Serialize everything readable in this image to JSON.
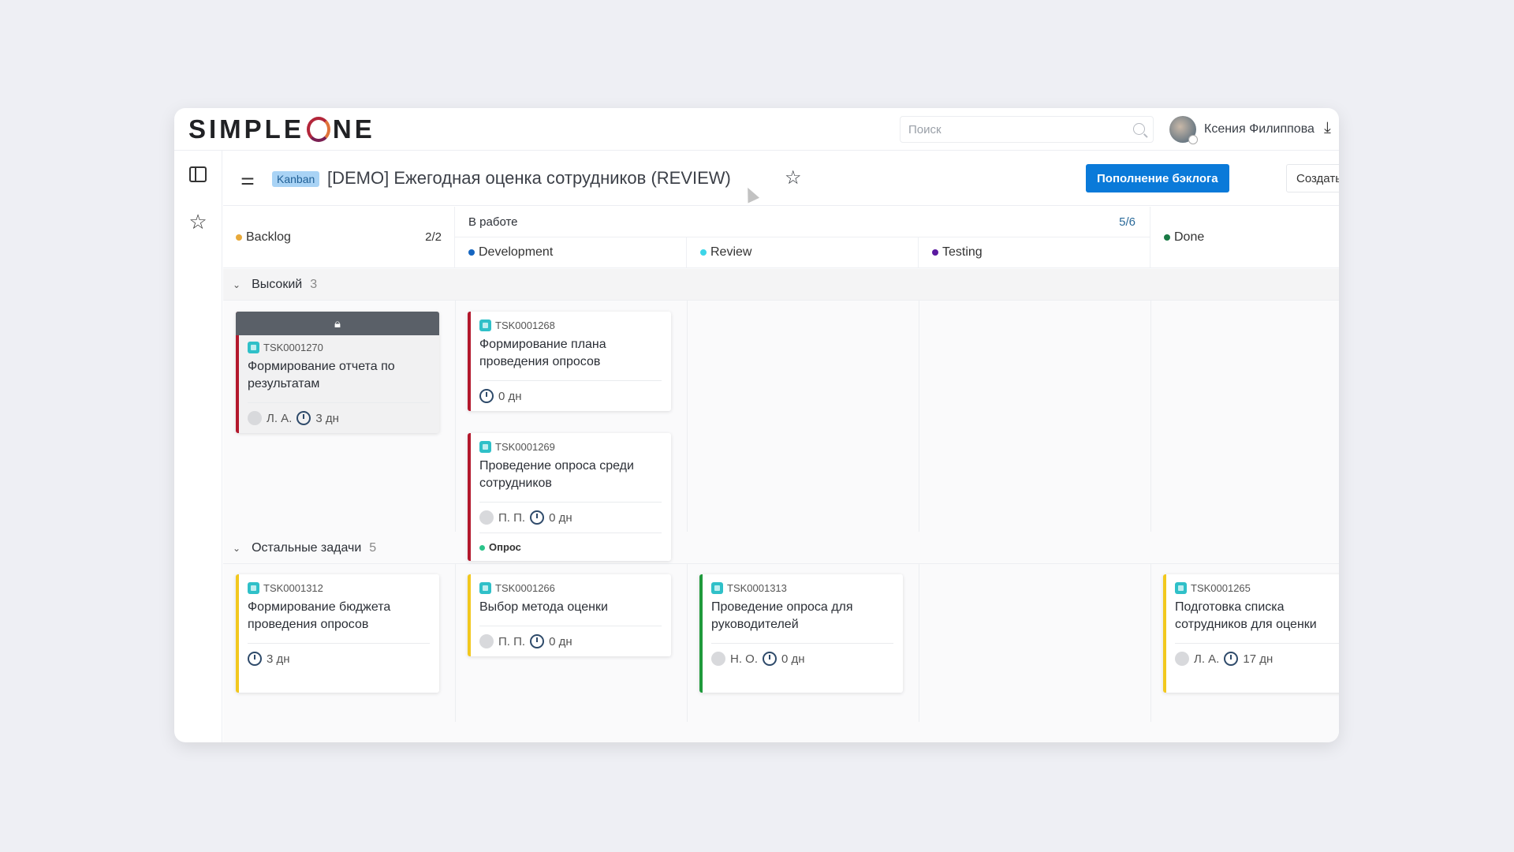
{
  "app": {
    "logo": "SIMPLEONE",
    "logo_left": "SIMPLE",
    "logo_right": "NE"
  },
  "search": {
    "placeholder": "Поиск"
  },
  "user": {
    "name": "Ксения Филиппова"
  },
  "titlebar": {
    "tag": "Kanban",
    "title": "[DEMO] Ежегодная оценка сотрудников (REVIEW)",
    "primary_button": "Пополнение бэклога",
    "secondary_button": "Создать задачу"
  },
  "columns": {
    "backlog": {
      "label": "Backlog",
      "count": "2/2",
      "color": "#e8a93a"
    },
    "in_work": {
      "label": "В работе",
      "count": "5/6"
    },
    "development": {
      "label": "Development",
      "color": "#1565c0"
    },
    "review": {
      "label": "Review",
      "color": "#3dd5e8"
    },
    "testing": {
      "label": "Testing",
      "color": "#5b1aa0"
    },
    "done": {
      "label": "Done",
      "color": "#197a45"
    }
  },
  "groups": [
    {
      "label": "Высокий",
      "count": "3"
    },
    {
      "label": "Остальные задачи",
      "count": "5"
    }
  ],
  "cards": [
    {
      "id": "TSK0001270",
      "title": "Формирование отчета по результатам",
      "assignee": "Л. А.",
      "duration": "3 дн",
      "locked": true,
      "stripe": "#b3182d"
    },
    {
      "id": "TSK0001268",
      "title": "Формирование плана проведения опросов",
      "assignee": "",
      "duration": "0 дн",
      "stripe": "#b3182d"
    },
    {
      "id": "TSK0001269",
      "title": "Проведение опроса среди сотрудников",
      "assignee": "П. П.",
      "duration": "0 дн",
      "tag": "Опрос",
      "tag_color": "#2bc48a",
      "stripe": "#b3182d"
    },
    {
      "id": "TSK0001312",
      "title": "Формирование бюджета проведения опросов",
      "assignee": "",
      "duration": "3 дн",
      "stripe": "#f2c81e"
    },
    {
      "id": "TSK0001266",
      "title": "Выбор метода оценки",
      "assignee": "П. П.",
      "duration": "0 дн",
      "stripe": "#f2c81e"
    },
    {
      "id": "TSK0001313",
      "title": "Проведение опроса для руководителей",
      "assignee": "Н. О.",
      "duration": "0 дн",
      "stripe": "#1f9a3c"
    },
    {
      "id": "TSK0001265",
      "title": "Подготовка списка сотрудников для оценки",
      "assignee": "Л. А.",
      "duration": "17 дн",
      "stripe": "#f2c81e"
    }
  ]
}
